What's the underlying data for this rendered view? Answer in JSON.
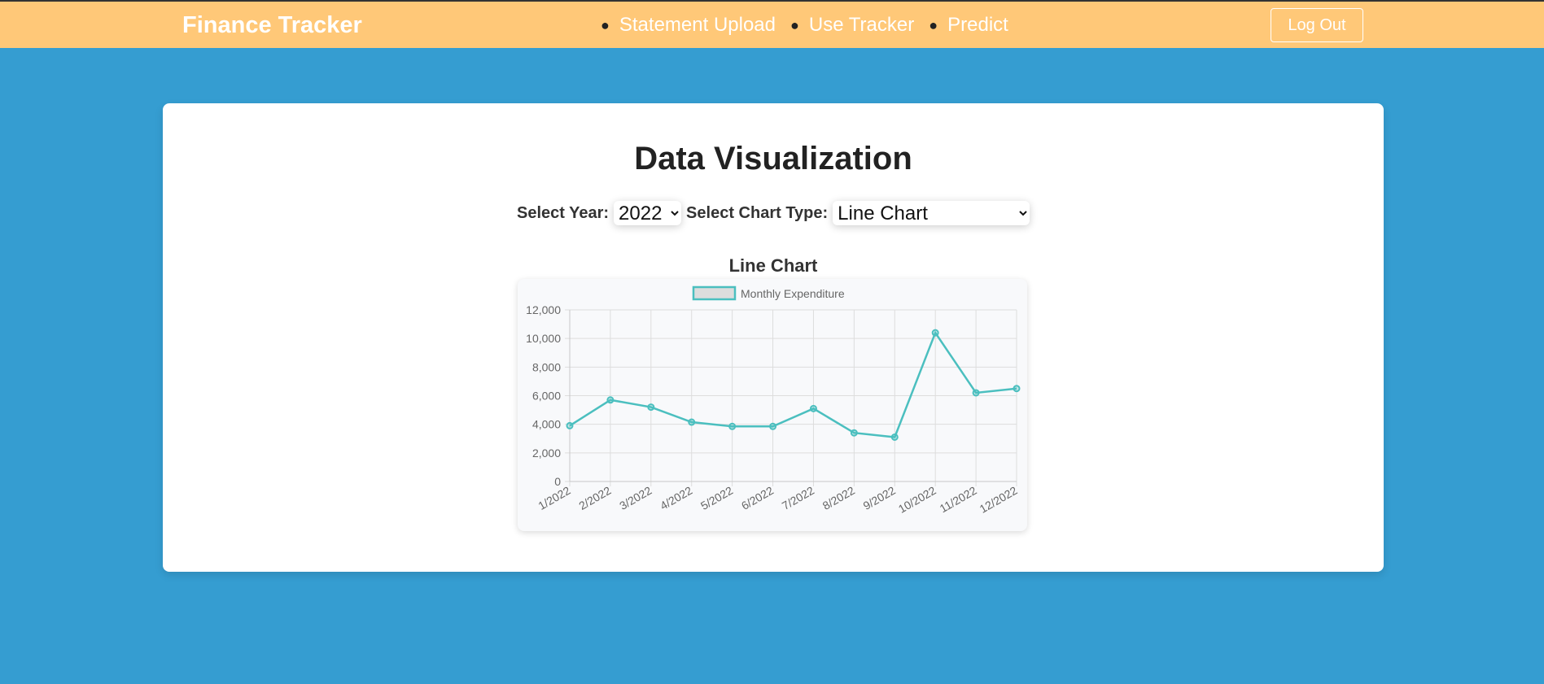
{
  "header": {
    "brand": "Finance Tracker",
    "nav": [
      "Statement Upload",
      "Use Tracker",
      "Predict"
    ],
    "logout_label": "Log Out"
  },
  "main": {
    "title": "Data Visualization",
    "year_label": "Select Year:",
    "year_value": "2022",
    "chart_type_label": "Select Chart Type:",
    "chart_type_value": "Line Chart",
    "chart_heading": "Line Chart"
  },
  "colors": {
    "header_bg": "#ffc878",
    "page_bg": "#359dd1",
    "series_line": "#4bbfbf"
  },
  "chart_data": {
    "type": "line",
    "title": "",
    "xlabel": "",
    "ylabel": "",
    "legend_position": "top",
    "grid": true,
    "categories": [
      "1/2022",
      "2/2022",
      "3/2022",
      "4/2022",
      "5/2022",
      "6/2022",
      "7/2022",
      "8/2022",
      "9/2022",
      "10/2022",
      "11/2022",
      "12/2022"
    ],
    "series": [
      {
        "name": "Monthly Expenditure",
        "values": [
          3900,
          5700,
          5200,
          4150,
          3850,
          3850,
          5100,
          3400,
          3100,
          10400,
          6200,
          6500
        ]
      }
    ],
    "ylim": [
      0,
      12000
    ],
    "yticks": [
      0,
      2000,
      4000,
      6000,
      8000,
      10000,
      12000
    ],
    "ytick_labels": [
      "0",
      "2,000",
      "4,000",
      "6,000",
      "8,000",
      "10,000",
      "12,000"
    ]
  }
}
